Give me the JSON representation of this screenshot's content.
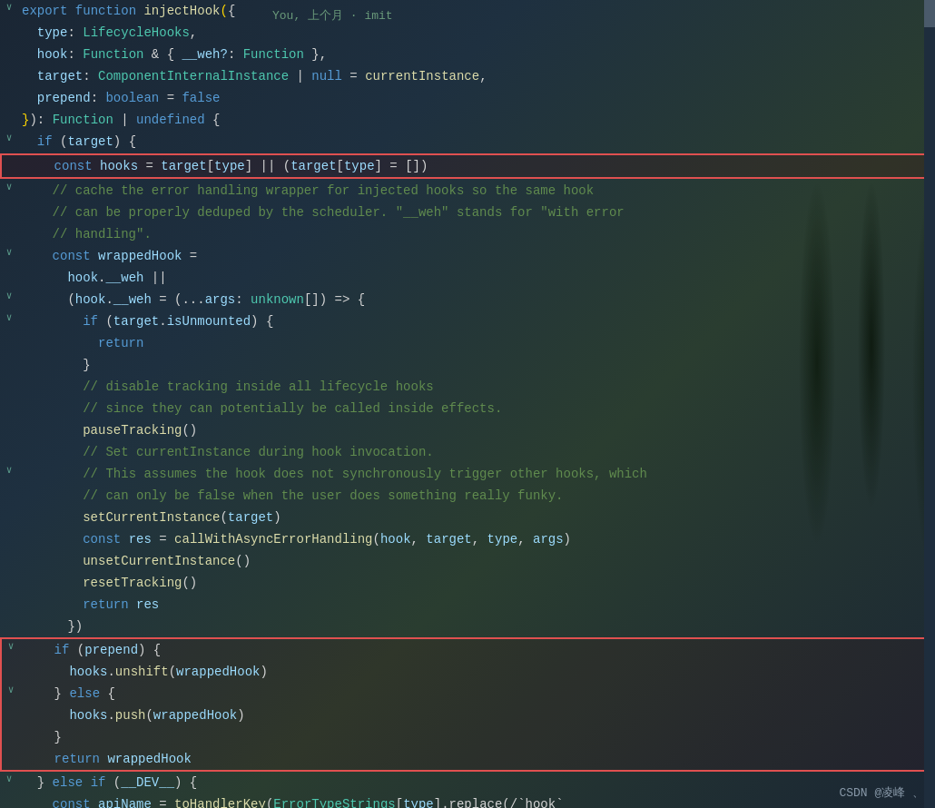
{
  "editor": {
    "commit_info": "You, 上个月 · imit",
    "watermark": "CSDN @凌峰 、",
    "lines": [
      {
        "id": 1,
        "fold": "v",
        "blame": "",
        "tokens": [
          {
            "t": "kw",
            "v": "export"
          },
          {
            "t": "white",
            "v": " "
          },
          {
            "t": "kw",
            "v": "function"
          },
          {
            "t": "white",
            "v": " "
          },
          {
            "t": "fn",
            "v": "injectHook"
          },
          {
            "t": "punct",
            "v": "("
          },
          {
            "t": "white",
            "v": "{"
          }
        ]
      },
      {
        "id": 2,
        "fold": "",
        "blame": "",
        "tokens": [
          {
            "t": "white",
            "v": "  "
          },
          {
            "t": "param",
            "v": "type"
          },
          {
            "t": "white",
            "v": ": "
          },
          {
            "t": "type",
            "v": "LifecycleHooks"
          },
          {
            "t": "white",
            "v": ","
          }
        ]
      },
      {
        "id": 3,
        "fold": "",
        "blame": "",
        "tokens": [
          {
            "t": "white",
            "v": "  "
          },
          {
            "t": "param",
            "v": "hook"
          },
          {
            "t": "white",
            "v": ": "
          },
          {
            "t": "type",
            "v": "Function"
          },
          {
            "t": "white",
            "v": " & { "
          },
          {
            "t": "param",
            "v": "__weh?"
          },
          {
            "t": "white",
            "v": ": "
          },
          {
            "t": "type",
            "v": "Function"
          },
          {
            "t": "white",
            "v": " },"
          }
        ]
      },
      {
        "id": 4,
        "fold": "",
        "blame": "",
        "tokens": [
          {
            "t": "white",
            "v": "  "
          },
          {
            "t": "param",
            "v": "target"
          },
          {
            "t": "white",
            "v": ": "
          },
          {
            "t": "type",
            "v": "ComponentInternalInstance"
          },
          {
            "t": "white",
            "v": " | "
          },
          {
            "t": "bool",
            "v": "null"
          },
          {
            "t": "white",
            "v": " = "
          },
          {
            "t": "fn",
            "v": "currentInstance"
          },
          {
            "t": "white",
            "v": ","
          }
        ]
      },
      {
        "id": 5,
        "fold": "",
        "blame": "",
        "tokens": [
          {
            "t": "white",
            "v": "  "
          },
          {
            "t": "param",
            "v": "prepend"
          },
          {
            "t": "white",
            "v": ": "
          },
          {
            "t": "bool",
            "v": "boolean"
          },
          {
            "t": "white",
            "v": " = "
          },
          {
            "t": "bool",
            "v": "false"
          }
        ]
      },
      {
        "id": 6,
        "fold": "",
        "blame": "",
        "tokens": [
          {
            "t": "punct",
            "v": "}"
          },
          {
            "t": "white",
            "v": "): "
          },
          {
            "t": "type",
            "v": "Function"
          },
          {
            "t": "white",
            "v": " | "
          },
          {
            "t": "bool",
            "v": "undefined"
          },
          {
            "t": "white",
            "v": " {"
          }
        ]
      },
      {
        "id": 7,
        "fold": "v",
        "blame": "",
        "tokens": [
          {
            "t": "white",
            "v": "  "
          },
          {
            "t": "kw",
            "v": "if"
          },
          {
            "t": "white",
            "v": " ("
          },
          {
            "t": "param",
            "v": "target"
          },
          {
            "t": "white",
            "v": ") {"
          }
        ]
      },
      {
        "id": 8,
        "fold": "",
        "blame": "",
        "highlight": "red",
        "tokens": [
          {
            "t": "white",
            "v": "    "
          },
          {
            "t": "kw",
            "v": "const"
          },
          {
            "t": "white",
            "v": " "
          },
          {
            "t": "param",
            "v": "hooks"
          },
          {
            "t": "white",
            "v": " = "
          },
          {
            "t": "param",
            "v": "target"
          },
          {
            "t": "white",
            "v": "["
          },
          {
            "t": "param",
            "v": "type"
          },
          {
            "t": "white",
            "v": "] || ("
          },
          {
            "t": "param",
            "v": "target"
          },
          {
            "t": "white",
            "v": "["
          },
          {
            "t": "param",
            "v": "type"
          },
          {
            "t": "white",
            "v": "] = [])"
          }
        ]
      },
      {
        "id": 9,
        "fold": "v",
        "blame": "",
        "tokens": [
          {
            "t": "white",
            "v": "    "
          },
          {
            "t": "comment",
            "v": "// cache the error handling wrapper for injected hooks so the same hook"
          }
        ]
      },
      {
        "id": 10,
        "fold": "",
        "blame": "",
        "tokens": [
          {
            "t": "white",
            "v": "    "
          },
          {
            "t": "comment",
            "v": "// can be properly deduped by the scheduler. \"__weh\" stands for \"with error"
          }
        ]
      },
      {
        "id": 11,
        "fold": "",
        "blame": "",
        "tokens": [
          {
            "t": "white",
            "v": "    "
          },
          {
            "t": "comment",
            "v": "// handling\"."
          }
        ]
      },
      {
        "id": 12,
        "fold": "v",
        "blame": "",
        "tokens": [
          {
            "t": "white",
            "v": "    "
          },
          {
            "t": "kw",
            "v": "const"
          },
          {
            "t": "white",
            "v": " "
          },
          {
            "t": "param",
            "v": "wrappedHook"
          },
          {
            "t": "white",
            "v": " ="
          }
        ]
      },
      {
        "id": 13,
        "fold": "",
        "blame": "",
        "tokens": [
          {
            "t": "white",
            "v": "      "
          },
          {
            "t": "param",
            "v": "hook"
          },
          {
            "t": "white",
            "v": "."
          },
          {
            "t": "prop",
            "v": "__weh"
          },
          {
            "t": "white",
            "v": " ||"
          }
        ]
      },
      {
        "id": 14,
        "fold": "v",
        "blame": "",
        "tokens": [
          {
            "t": "white",
            "v": "      ("
          },
          {
            "t": "param",
            "v": "hook"
          },
          {
            "t": "white",
            "v": "."
          },
          {
            "t": "prop",
            "v": "__weh"
          },
          {
            "t": "white",
            "v": " = (..."
          },
          {
            "t": "param",
            "v": "args"
          },
          {
            "t": "white",
            "v": ": "
          },
          {
            "t": "type",
            "v": "unknown"
          },
          {
            "t": "white",
            "v": "[]) => {"
          }
        ]
      },
      {
        "id": 15,
        "fold": "v",
        "blame": "",
        "tokens": [
          {
            "t": "white",
            "v": "        "
          },
          {
            "t": "kw",
            "v": "if"
          },
          {
            "t": "white",
            "v": " ("
          },
          {
            "t": "param",
            "v": "target"
          },
          {
            "t": "white",
            "v": "."
          },
          {
            "t": "prop",
            "v": "isUnmounted"
          },
          {
            "t": "white",
            "v": ") {"
          }
        ]
      },
      {
        "id": 16,
        "fold": "",
        "blame": "",
        "tokens": [
          {
            "t": "white",
            "v": "          "
          },
          {
            "t": "kw",
            "v": "return"
          }
        ]
      },
      {
        "id": 17,
        "fold": "",
        "blame": "",
        "tokens": [
          {
            "t": "white",
            "v": "        }"
          }
        ]
      },
      {
        "id": 18,
        "fold": "",
        "blame": "",
        "tokens": [
          {
            "t": "white",
            "v": "        "
          },
          {
            "t": "comment",
            "v": "// disable tracking inside all lifecycle hooks"
          }
        ]
      },
      {
        "id": 19,
        "fold": "",
        "blame": "",
        "tokens": [
          {
            "t": "white",
            "v": "        "
          },
          {
            "t": "comment",
            "v": "// since they can potentially be called inside effects."
          }
        ]
      },
      {
        "id": 20,
        "fold": "",
        "blame": "",
        "tokens": [
          {
            "t": "white",
            "v": "        "
          },
          {
            "t": "fn",
            "v": "pauseTracking"
          },
          {
            "t": "white",
            "v": "()"
          }
        ]
      },
      {
        "id": 21,
        "fold": "",
        "blame": "",
        "tokens": [
          {
            "t": "white",
            "v": "        "
          },
          {
            "t": "comment",
            "v": "// Set currentInstance during hook invocation."
          }
        ]
      },
      {
        "id": 22,
        "fold": "v",
        "blame": "",
        "tokens": [
          {
            "t": "white",
            "v": "        "
          },
          {
            "t": "comment",
            "v": "// This assumes the hook does not synchronously trigger other hooks, which"
          }
        ]
      },
      {
        "id": 23,
        "fold": "",
        "blame": "",
        "tokens": [
          {
            "t": "white",
            "v": "        "
          },
          {
            "t": "comment",
            "v": "// can only be false when the user does something really funky."
          }
        ]
      },
      {
        "id": 24,
        "fold": "",
        "blame": "",
        "tokens": [
          {
            "t": "white",
            "v": "        "
          },
          {
            "t": "fn",
            "v": "setCurrentInstance"
          },
          {
            "t": "white",
            "v": "("
          },
          {
            "t": "param",
            "v": "target"
          },
          {
            "t": "white",
            "v": ")"
          }
        ]
      },
      {
        "id": 25,
        "fold": "",
        "blame": "",
        "tokens": [
          {
            "t": "white",
            "v": "        "
          },
          {
            "t": "kw",
            "v": "const"
          },
          {
            "t": "white",
            "v": " "
          },
          {
            "t": "param",
            "v": "res"
          },
          {
            "t": "white",
            "v": " = "
          },
          {
            "t": "fn",
            "v": "callWithAsyncErrorHandling"
          },
          {
            "t": "white",
            "v": "("
          },
          {
            "t": "param",
            "v": "hook"
          },
          {
            "t": "white",
            "v": ", "
          },
          {
            "t": "param",
            "v": "target"
          },
          {
            "t": "white",
            "v": ", "
          },
          {
            "t": "param",
            "v": "type"
          },
          {
            "t": "white",
            "v": ", "
          },
          {
            "t": "param",
            "v": "args"
          },
          {
            "t": "white",
            "v": ")"
          }
        ]
      },
      {
        "id": 26,
        "fold": "",
        "blame": "",
        "tokens": [
          {
            "t": "white",
            "v": "        "
          },
          {
            "t": "fn",
            "v": "unsetCurrentInstance"
          },
          {
            "t": "white",
            "v": "()"
          }
        ]
      },
      {
        "id": 27,
        "fold": "",
        "blame": "",
        "tokens": [
          {
            "t": "white",
            "v": "        "
          },
          {
            "t": "fn",
            "v": "resetTracking"
          },
          {
            "t": "white",
            "v": "()"
          }
        ]
      },
      {
        "id": 28,
        "fold": "",
        "blame": "",
        "tokens": [
          {
            "t": "white",
            "v": "        "
          },
          {
            "t": "kw",
            "v": "return"
          },
          {
            "t": "white",
            "v": " "
          },
          {
            "t": "param",
            "v": "res"
          }
        ]
      },
      {
        "id": 29,
        "fold": "",
        "blame": "",
        "tokens": [
          {
            "t": "white",
            "v": "      })"
          }
        ]
      },
      {
        "id": 30,
        "fold": "v",
        "blame": "",
        "tokens": [
          {
            "t": "white",
            "v": "    "
          },
          {
            "t": "kw",
            "v": "if"
          },
          {
            "t": "white",
            "v": " ("
          },
          {
            "t": "param",
            "v": "prepend"
          },
          {
            "t": "white",
            "v": ") {"
          }
        ]
      },
      {
        "id": 31,
        "fold": "",
        "blame": "",
        "tokens": [
          {
            "t": "white",
            "v": "      "
          },
          {
            "t": "param",
            "v": "hooks"
          },
          {
            "t": "white",
            "v": "."
          },
          {
            "t": "fn",
            "v": "unshift"
          },
          {
            "t": "white",
            "v": "("
          },
          {
            "t": "param",
            "v": "wrappedHook"
          },
          {
            "t": "white",
            "v": ")"
          }
        ]
      },
      {
        "id": 32,
        "fold": "v",
        "blame": "",
        "tokens": [
          {
            "t": "white",
            "v": "    } "
          },
          {
            "t": "kw",
            "v": "else"
          },
          {
            "t": "white",
            "v": " {"
          }
        ]
      },
      {
        "id": 33,
        "fold": "",
        "blame": "",
        "tokens": [
          {
            "t": "white",
            "v": "      "
          },
          {
            "t": "param",
            "v": "hooks"
          },
          {
            "t": "white",
            "v": "."
          },
          {
            "t": "fn",
            "v": "push"
          },
          {
            "t": "white",
            "v": "("
          },
          {
            "t": "param",
            "v": "wrappedHook"
          },
          {
            "t": "white",
            "v": ")"
          }
        ]
      },
      {
        "id": 34,
        "fold": "",
        "blame": "",
        "tokens": [
          {
            "t": "white",
            "v": "    }"
          }
        ]
      },
      {
        "id": 35,
        "fold": "",
        "blame": "",
        "tokens": [
          {
            "t": "white",
            "v": "    "
          },
          {
            "t": "kw",
            "v": "return"
          },
          {
            "t": "white",
            "v": " "
          },
          {
            "t": "param",
            "v": "wrappedHook"
          }
        ]
      },
      {
        "id": 36,
        "fold": "v",
        "blame": "",
        "tokens": [
          {
            "t": "white",
            "v": "  } "
          },
          {
            "t": "kw",
            "v": "else"
          },
          {
            "t": "white",
            "v": " "
          },
          {
            "t": "kw",
            "v": "if"
          },
          {
            "t": "white",
            "v": " ("
          },
          {
            "t": "param",
            "v": "__DEV__"
          },
          {
            "t": "white",
            "v": ") {"
          }
        ]
      },
      {
        "id": 37,
        "fold": "",
        "blame": "",
        "tokens": [
          {
            "t": "white",
            "v": "    "
          },
          {
            "t": "kw",
            "v": "const"
          },
          {
            "t": "white",
            "v": " "
          },
          {
            "t": "param",
            "v": "apiName"
          },
          {
            "t": "white",
            "v": " = "
          },
          {
            "t": "fn",
            "v": "toHandlerKey"
          },
          {
            "t": "white",
            "v": "("
          },
          {
            "t": "type",
            "v": "ErrorTypeStrings"
          },
          {
            "t": "white",
            "v": "["
          },
          {
            "t": "param",
            "v": "type"
          },
          {
            "t": "white",
            "v": "].replace(/`hook`"
          },
          {
            "t": "white",
            "v": " "
          }
        ]
      }
    ],
    "highlight_line_8": true,
    "highlight_block_30_35": true
  }
}
